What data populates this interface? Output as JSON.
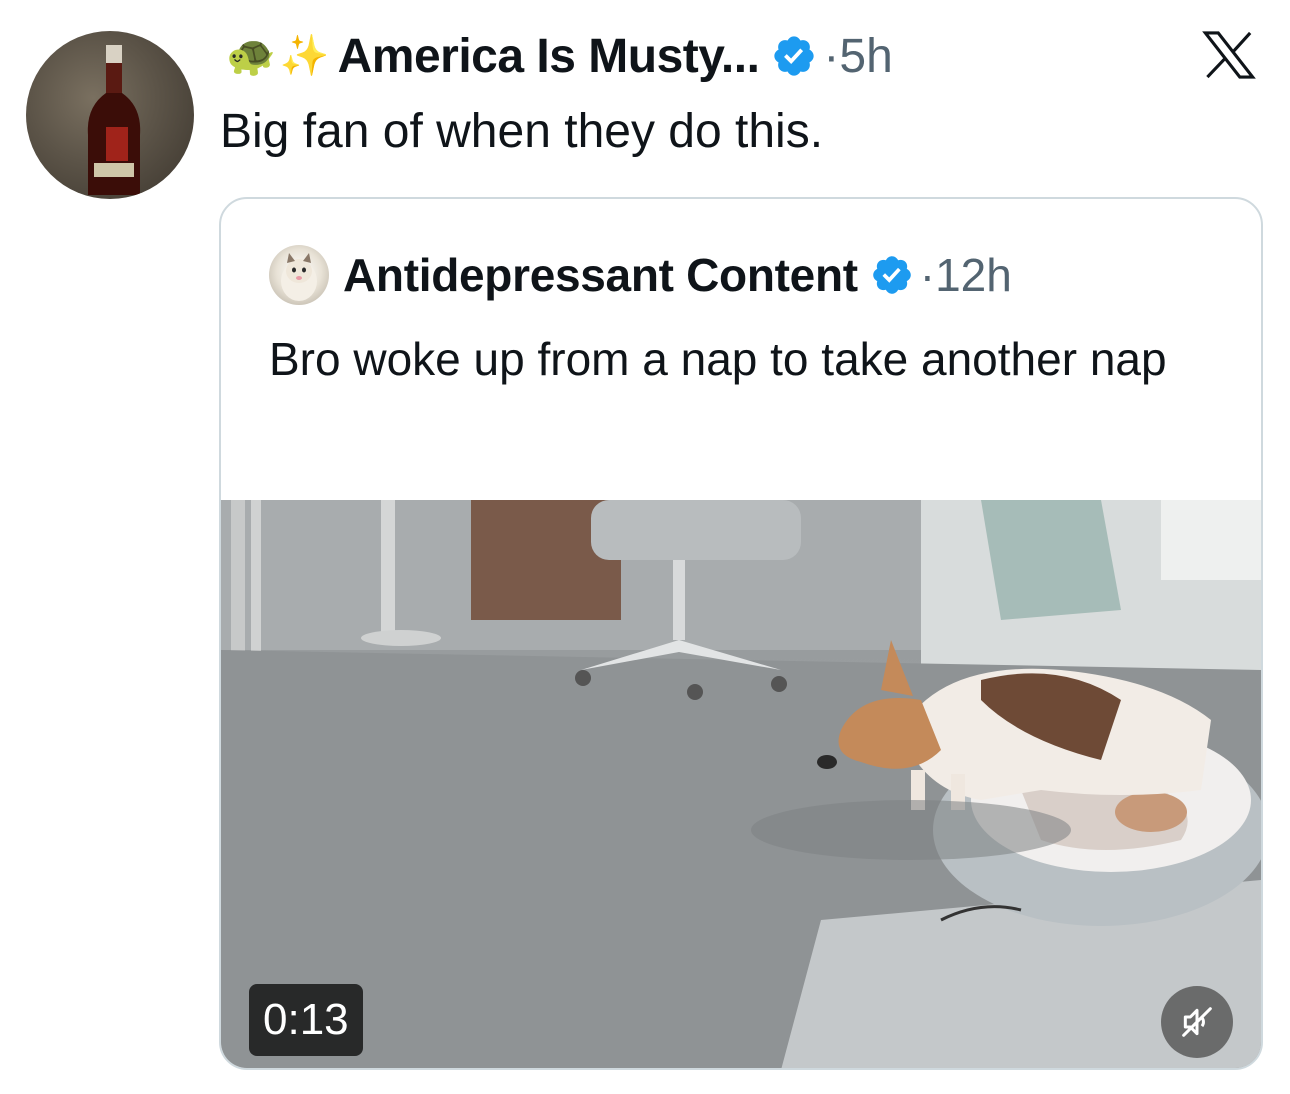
{
  "post": {
    "author_emoji_1": "🐢",
    "author_emoji_2": "✨",
    "author_name": "America Is Musty...",
    "separator": "·",
    "time": "5h",
    "text": "Big fan of when they do this.",
    "avatar_icon": "avatar-bottle",
    "brand_icon": "x-logo-icon"
  },
  "quote": {
    "author_name": "Antidepressant Content",
    "separator": "·",
    "time": "12h",
    "text": "Bro woke up from a nap to take another nap",
    "video": {
      "duration": "0:13",
      "mute_icon": "muted-speaker-icon"
    }
  },
  "colors": {
    "verified": "#1d9bf0",
    "secondary_text": "#536471",
    "border": "#cfd9de"
  }
}
